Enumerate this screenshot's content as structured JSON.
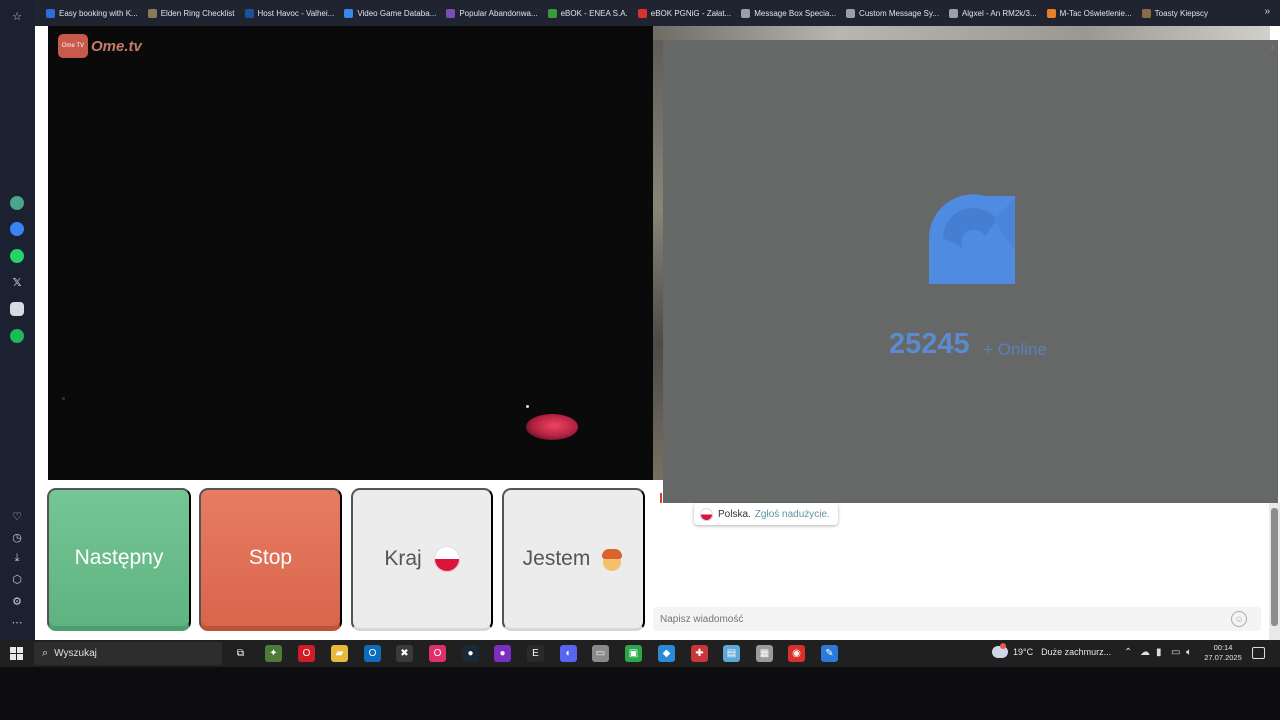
{
  "bookmarks": [
    {
      "label": "Easy booking with K...",
      "color": "#2a6fd6"
    },
    {
      "label": "Elden Ring Checklist",
      "color": "#8a7a5a"
    },
    {
      "label": "Host Havoc - Valhei...",
      "color": "#1c4f9c"
    },
    {
      "label": "Video Game Databa...",
      "color": "#3b88e8"
    },
    {
      "label": "Popular Abandonwa...",
      "color": "#7a4fb5"
    },
    {
      "label": "eBOK - ENEA S.A.",
      "color": "#3a9a3a"
    },
    {
      "label": "eBOK PGNiG - Załat...",
      "color": "#d9342b"
    },
    {
      "label": "Message Box Specia...",
      "color": "#9aa0a8"
    },
    {
      "label": "Custom Message Sy...",
      "color": "#9aa0a8"
    },
    {
      "label": "Algxel - An RM2k/3...",
      "color": "#9aa0a8"
    },
    {
      "label": "M-Tac Oświetlenie...",
      "color": "#e8802b"
    },
    {
      "label": "Toasty Kiepscy",
      "color": "#8a6a4a"
    }
  ],
  "bookmarks_more": "»",
  "sidebar": {
    "icons": [
      {
        "name": "chatgpt-icon",
        "color": "#4aa58a"
      },
      {
        "name": "messenger-icon",
        "color": "#3b82f6"
      },
      {
        "name": "whatsapp-icon",
        "color": "#25d366"
      },
      {
        "name": "x-twitter-icon",
        "color": "#e8e8e8"
      },
      {
        "name": "discord-icon",
        "color": "#e8e8e8"
      },
      {
        "name": "spotify-icon",
        "color": "#1db954"
      }
    ]
  },
  "logo": {
    "badge": "Ome TV",
    "text": "Ome.tv"
  },
  "online": {
    "count": "25245",
    "label": "+ Online",
    "color": "#5b8ad0"
  },
  "buttons": {
    "next": "Następny",
    "stop": "Stop",
    "country": "Kraj",
    "gender": "Jestem"
  },
  "chat": {
    "country": "Polska.",
    "report": "Zgłoś nadużycie.",
    "placeholder": "Napisz wiadomość"
  },
  "taskbar": {
    "search_placeholder": "Wyszukaj",
    "apps": [
      {
        "name": "task-view-icon",
        "glyph": "⧉",
        "color": "#202020"
      },
      {
        "name": "game-app-icon",
        "glyph": "✦",
        "color": "#4e7a3a"
      },
      {
        "name": "opera-icon",
        "glyph": "O",
        "color": "#d01b28"
      },
      {
        "name": "file-explorer-icon",
        "glyph": "▰",
        "color": "#e8b93a"
      },
      {
        "name": "outlook-icon",
        "glyph": "O",
        "color": "#0f6cbd"
      },
      {
        "name": "minecraft-icon",
        "glyph": "✖",
        "color": "#3a3a3a"
      },
      {
        "name": "opera-gx-icon",
        "glyph": "O",
        "color": "#e0306a"
      },
      {
        "name": "steam-icon",
        "glyph": "●",
        "color": "#1b2838"
      },
      {
        "name": "circle-app-icon",
        "glyph": "●",
        "color": "#7b2fbe"
      },
      {
        "name": "epic-games-icon",
        "glyph": "E",
        "color": "#2a2a2a"
      },
      {
        "name": "discord-taskbar-icon",
        "glyph": "◐",
        "color": "#5865f2"
      },
      {
        "name": "folder-app-icon",
        "glyph": "▭",
        "color": "#8a8a8a"
      },
      {
        "name": "green-app-icon",
        "glyph": "▣",
        "color": "#2aa84a"
      },
      {
        "name": "blue-app-icon",
        "glyph": "◆",
        "color": "#2a8ad8"
      },
      {
        "name": "red-app-icon",
        "glyph": "✚",
        "color": "#c8383a"
      },
      {
        "name": "window-app-icon",
        "glyph": "▤",
        "color": "#5ea8d8"
      },
      {
        "name": "grey-app-icon",
        "glyph": "▦",
        "color": "#9a9a9a"
      },
      {
        "name": "record-app-icon",
        "glyph": "◉",
        "color": "#d8302a"
      },
      {
        "name": "paint-app-icon",
        "glyph": "✎",
        "color": "#2a7ad8"
      }
    ],
    "weather_temp": "19°C",
    "weather_desc": "Duże zachmurz...",
    "time": "00:14",
    "date": "27.07.2025"
  }
}
